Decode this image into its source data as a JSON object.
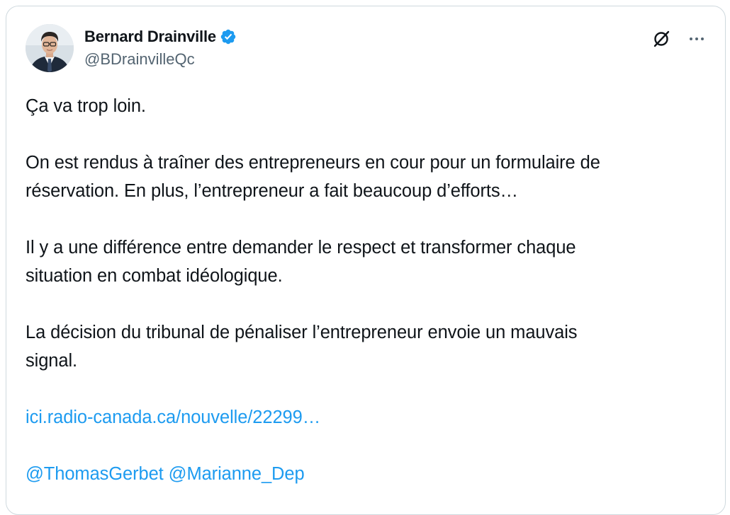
{
  "author": {
    "display_name": "Bernard Drainville",
    "handle": "@BDrainvilleQc",
    "verified": true
  },
  "icons": {
    "avatar": "profile-photo",
    "verified": "verified-badge-icon",
    "grok": "grok-icon",
    "more": "more-options-icon"
  },
  "colors": {
    "link": "#1d9bf0",
    "verified_badge": "#1d9bf0",
    "secondary_text": "#536471",
    "primary_text": "#0f1419",
    "border": "#cfd9de"
  },
  "tweet": {
    "p1": "Ça va trop loin.",
    "p2_line1": "On est rendus à traîner des entrepreneurs en cour pour un formulaire de",
    "p2_line2": "réservation. En plus, l’entrepreneur a fait beaucoup d’efforts…",
    "p3_line1": "Il y a une différence entre demander le respect et transformer chaque",
    "p3_line2": "situation en combat idéologique.",
    "p4_line1": "La décision du tribunal de pénaliser l’entrepreneur envoie un mauvais",
    "p4_line2": "signal.",
    "link_url_text": "ici.radio-canada.ca/nouvelle/22299…",
    "mention1": "@ThomasGerbet",
    "mention2": "@Marianne_Dep"
  }
}
